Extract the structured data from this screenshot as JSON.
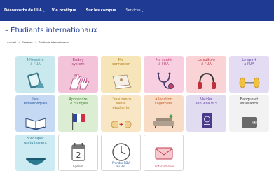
{
  "nav": {
    "items": [
      {
        "label": "Découverte de l'UA",
        "caret": "▾"
      },
      {
        "label": "Vie pratique",
        "caret": "▾"
      },
      {
        "label": "Sur les campus",
        "caret": "▾"
      },
      {
        "label": "Services",
        "caret": "▾"
      }
    ]
  },
  "page": {
    "title": "– Étudiants internationaux"
  },
  "breadcrumb": {
    "items": [
      "Accueil",
      "Services",
      "Étudiants internationaux"
    ],
    "separator": ">"
  },
  "tiles": [
    {
      "label": "M'inscrire\nà l'UA",
      "bg": "#c9e9ef",
      "color": "#4a8fa0",
      "icon": "tablet-icon"
    },
    {
      "label": "Buddy\nsystem",
      "bg": "#f2c3d9",
      "color": "#b0407a",
      "icon": "hands-icon"
    },
    {
      "label": "Me\nconnecter",
      "bg": "#f6e5b8",
      "color": "#b07a1a",
      "icon": "laptop-icon"
    },
    {
      "label": "Ma santé\nà l'UA",
      "bg": "#f7cfe0",
      "color": "#c03a70",
      "icon": "stethoscope-icon"
    },
    {
      "label": "La culture\nà l'UA",
      "bg": "#f9d3d6",
      "color": "#c0303a",
      "icon": "headphones-icon"
    },
    {
      "label": "Le sport\nà l'UA",
      "bg": "#e4dcf3",
      "color": "#6a4ab0",
      "icon": "dumbbell-icon"
    },
    {
      "label": "Les\nbibliothèques",
      "bg": "#c6d9f2",
      "color": "#2a5aa0",
      "icon": "book-icon"
    },
    {
      "label": "Apprendre\nLe Français",
      "bg": "#dbeed3",
      "color": "#4a8a3a",
      "icon": "flag-icon"
    },
    {
      "label": "L'assurance\nsanté\nétudiante",
      "bg": "#f8e6c4",
      "color": "#b07a1a",
      "icon": "bandage-icon"
    },
    {
      "label": "Allocation\nLogement",
      "bg": "#f9dcc6",
      "color": "#c0602a",
      "icon": "sofa-icon"
    },
    {
      "label": "Valider\nson visa VLS",
      "bg": "#e2dcf0",
      "color": "#5a3a9a",
      "icon": "passport-icon"
    },
    {
      "label": "Banque et\nassurance",
      "bg": "#f2f2f2",
      "color": "#444444",
      "icon": "wallet-icon"
    },
    {
      "label": "S'équiper\ngratuitement",
      "bg": "#cdebf2",
      "color": "#2a7a90",
      "icon": "bowl-icon"
    },
    {
      "label": "Agenda",
      "bg": "#ffffff",
      "color": "#555555",
      "icon": "calendar-icon",
      "blank": true
    },
    {
      "label": "Prendre RDV\nau BBI",
      "bg": "#ffffff",
      "color": "#2a5aa0",
      "icon": "clock-icon",
      "blank": true
    },
    {
      "label": "Contactez-nous",
      "bg": "#ffffff",
      "color": "#c03a50",
      "icon": "envelope-icon",
      "blank": true
    }
  ],
  "calendar_day": "2"
}
